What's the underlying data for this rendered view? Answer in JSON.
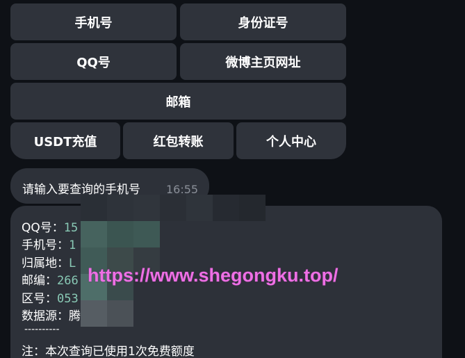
{
  "keyboard": {
    "row1": [
      "手机号",
      "身份证号"
    ],
    "row2": [
      "QQ号",
      "微博主页网址"
    ],
    "row3": [
      "邮箱"
    ],
    "row4": [
      "USDT充值",
      "红包转账",
      "个人中心"
    ]
  },
  "chat": {
    "prompt": {
      "text": "请输入要查询的手机号",
      "time": "16:55"
    },
    "result": {
      "lines": [
        {
          "label": "QQ号：",
          "value": "15"
        },
        {
          "label": "手机号：",
          "value": "1"
        },
        {
          "label": "归属地：",
          "value": "L"
        },
        {
          "label": "邮编：",
          "value": "266"
        },
        {
          "label": "区号：",
          "value": "053"
        },
        {
          "label": "数据源：",
          "value": "腾"
        }
      ],
      "separator": "----------",
      "note": "注：本次查询已使用1次免费额度"
    }
  },
  "watermark": "https://www.shegongku.top/",
  "colors": {
    "background": "#0e1116",
    "button": "#2f333b",
    "bubble": "#2d3139",
    "mono_value": "#89c9b5",
    "watermark": "#ee6fe5"
  }
}
